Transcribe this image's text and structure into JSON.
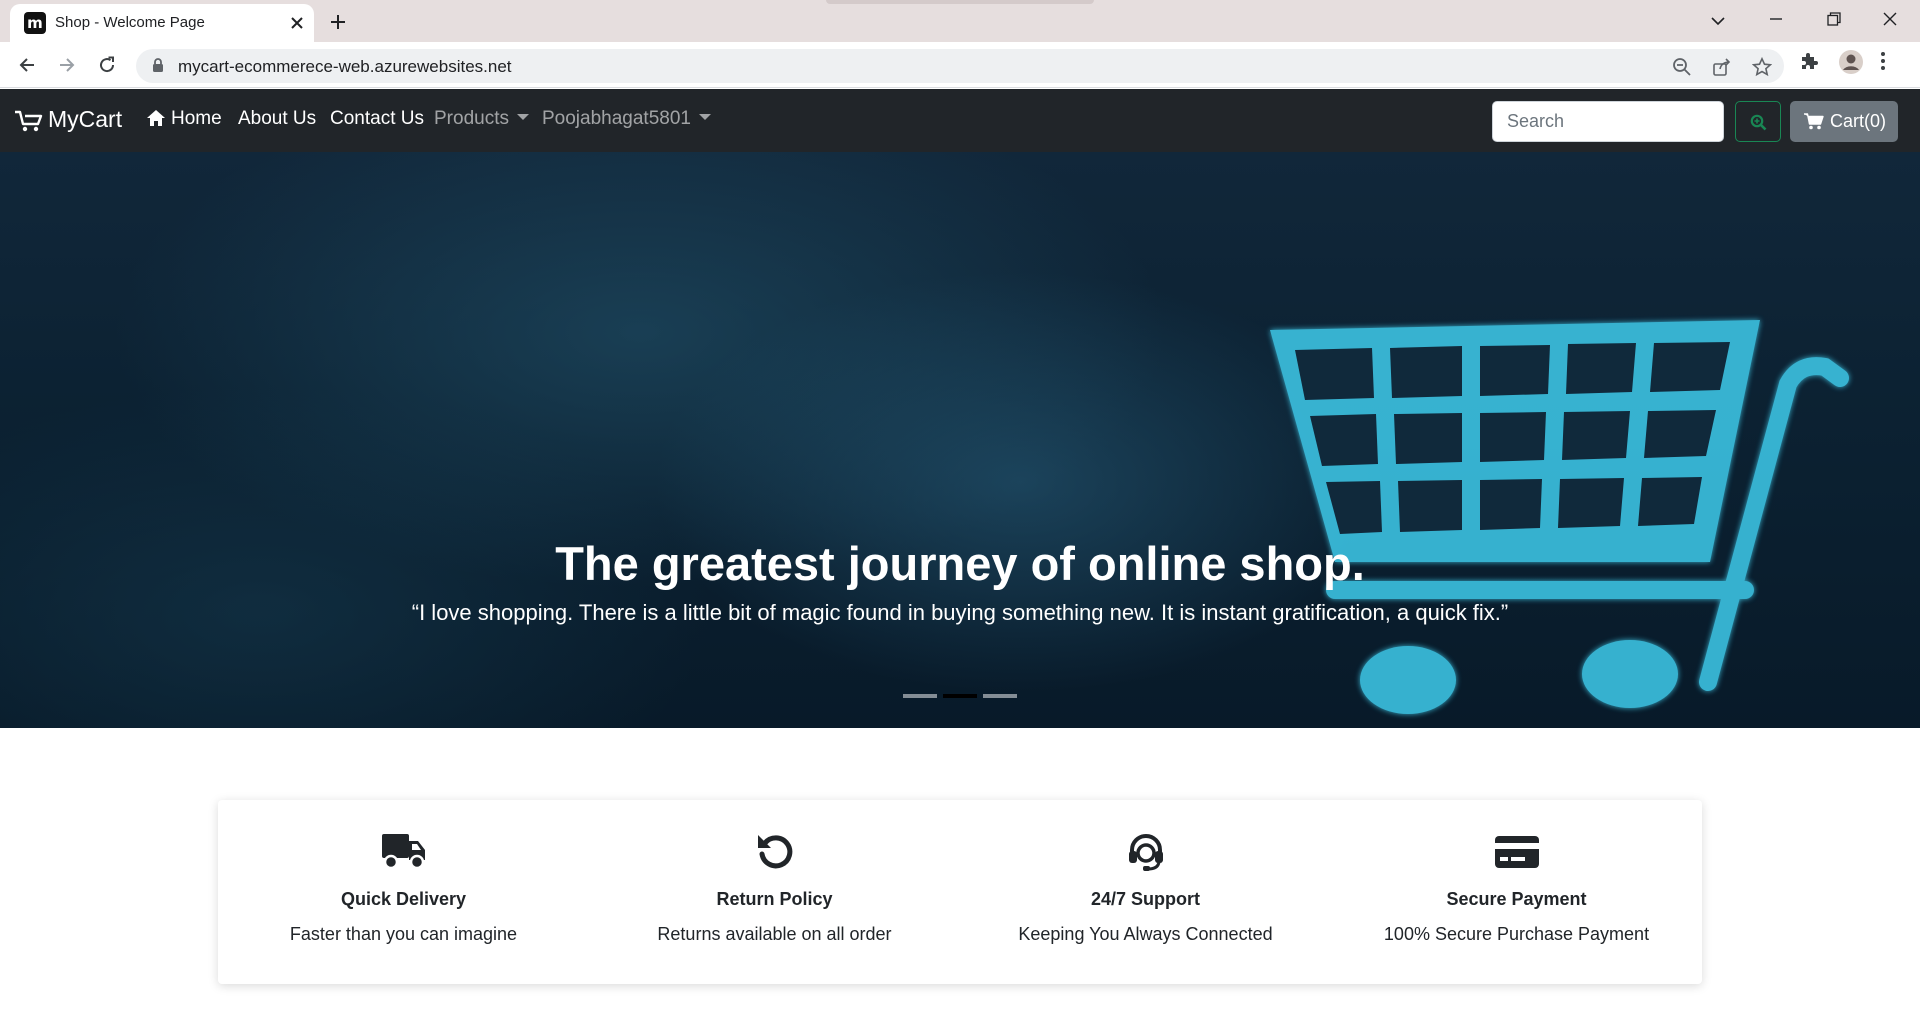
{
  "browser": {
    "tab_title": "Shop - Welcome Page",
    "favicon_letter": "m",
    "url": "mycart-ecommerece-web.azurewebsites.net"
  },
  "navbar": {
    "brand": "MyCart",
    "links": [
      {
        "label": "Home"
      },
      {
        "label": "About Us"
      },
      {
        "label": "Contact Us"
      },
      {
        "label": "Products"
      },
      {
        "label": "Poojabhagat5801"
      }
    ],
    "search_placeholder": "Search",
    "cart_label": "Cart(0)"
  },
  "hero": {
    "title": "The greatest journey of online shop.",
    "quote": "“I love shopping. There is a little bit of magic found in buying something new. It is instant gratification, a quick fix.”",
    "slides": 3,
    "active_slide": 2
  },
  "features": [
    {
      "icon": "truck-icon",
      "title": "Quick Delivery",
      "desc": "Faster than you can imagine"
    },
    {
      "icon": "undo-icon",
      "title": "Return Policy",
      "desc": "Returns available on all order"
    },
    {
      "icon": "headset-icon",
      "title": "24/7 Support",
      "desc": "Keeping You Always Connected"
    },
    {
      "icon": "credit-card-icon",
      "title": "Secure Payment",
      "desc": "100% Secure Purchase Payment"
    }
  ],
  "colors": {
    "navbar_bg": "#212529",
    "cart_button_bg": "#6c757d",
    "search_button_border": "#198754",
    "hero_cart": "#3ec6e6"
  }
}
